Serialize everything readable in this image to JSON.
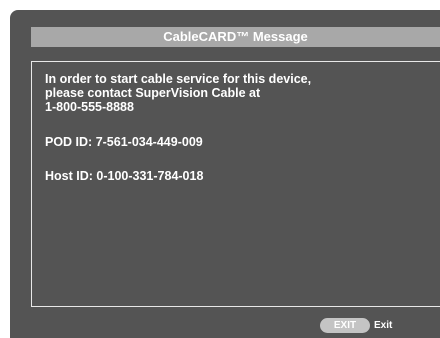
{
  "dialog": {
    "title": "CableCARD™ Message",
    "message_lines": [
      "In order to start cable service for this device,",
      "please contact SuperVision Cable at",
      "1-800-555-8888"
    ],
    "pod_id": "POD ID: 7-561-034-449-009",
    "host_id": "Host ID: 0-100-331-784-018"
  },
  "footer": {
    "exit_button_label": "EXIT",
    "exit_hint": "Exit"
  },
  "colors": {
    "background": "#545454",
    "title_bar": "#a8a8a8",
    "text": "#ffffff",
    "button": "#c4c4c4"
  }
}
